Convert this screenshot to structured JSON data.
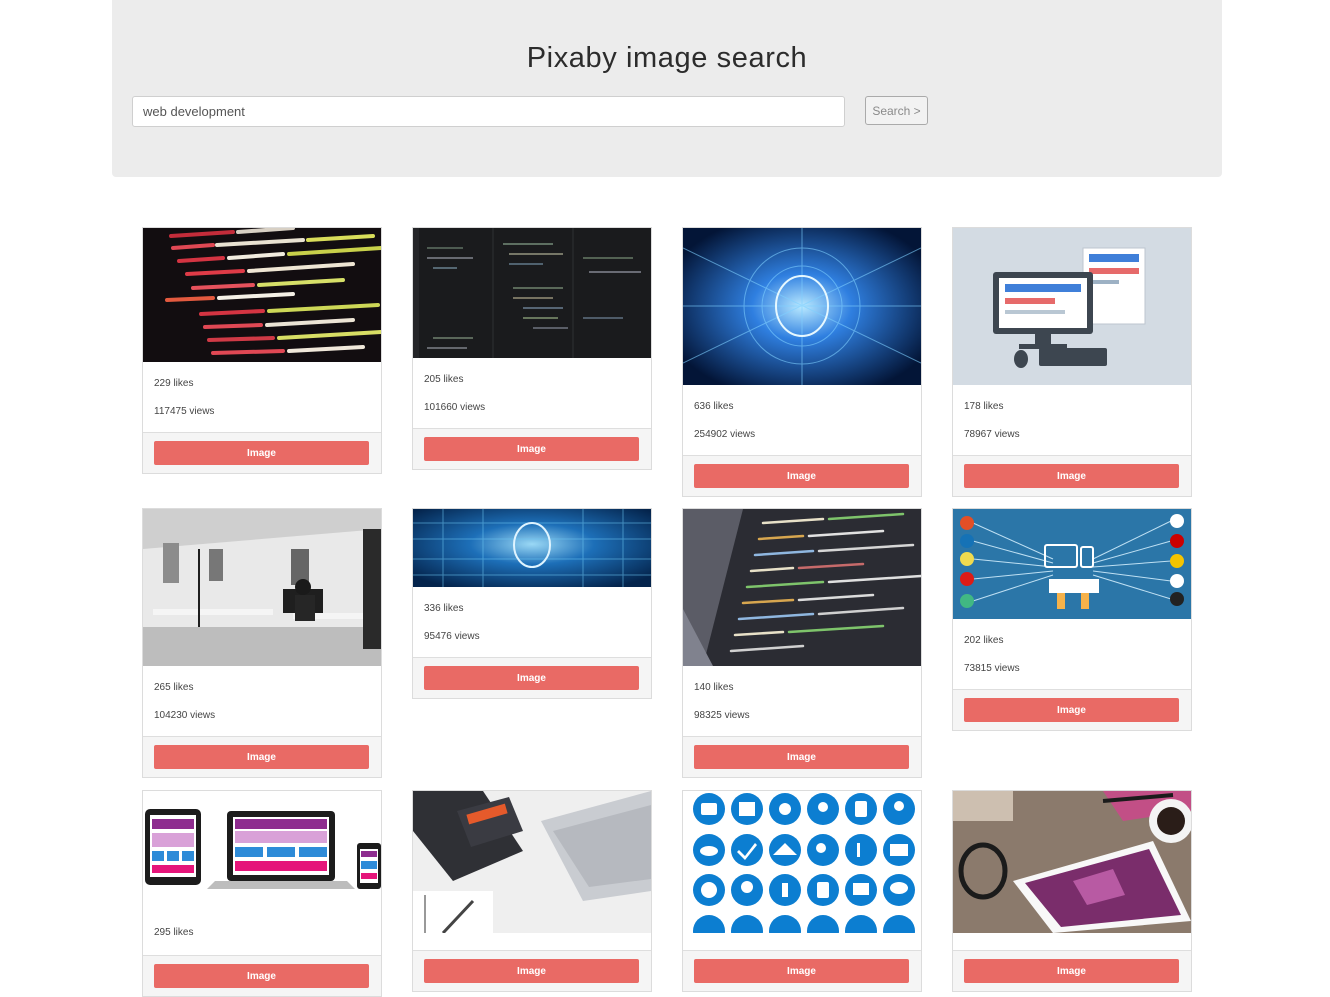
{
  "header": {
    "title": "Pixaby image search",
    "search_value": "web development",
    "search_button": "Search >"
  },
  "cards": [
    {
      "likes": "229 likes",
      "views": "117475 views",
      "button": "Image",
      "thumb": "code-screen-dark"
    },
    {
      "likes": "205 likes",
      "views": "101660 views",
      "button": "Image",
      "thumb": "code-editor-dark"
    },
    {
      "likes": "636 likes",
      "views": "254902 views",
      "button": "Image",
      "thumb": "ai-brain-circuit"
    },
    {
      "likes": "178 likes",
      "views": "78967 views",
      "button": "Image",
      "thumb": "desktop-computer-illustration"
    },
    {
      "likes": "265 likes",
      "views": "104230 views",
      "button": "Image",
      "thumb": "office-bw"
    },
    {
      "likes": "336 likes",
      "views": "95476 views",
      "button": "Image",
      "thumb": "ai-head-banner"
    },
    {
      "likes": "140 likes",
      "views": "98325 views",
      "button": "Image",
      "thumb": "code-screen-angle"
    },
    {
      "likes": "202 likes",
      "views": "73815 views",
      "button": "Image",
      "thumb": "web-tech-icons"
    },
    {
      "likes": "295 likes",
      "views": "",
      "button": "Image",
      "thumb": "responsive-devices"
    },
    {
      "likes": "",
      "views": "",
      "button": "Image",
      "thumb": "html-css-book-laptop"
    },
    {
      "likes": "",
      "views": "",
      "button": "Image",
      "thumb": "blue-web-icons"
    },
    {
      "likes": "",
      "views": "",
      "button": "Image",
      "thumb": "tablet-desk"
    }
  ]
}
